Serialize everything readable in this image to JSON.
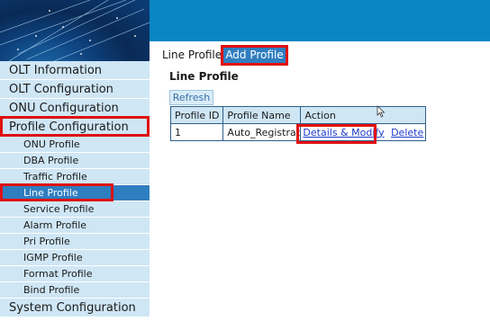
{
  "sidebar": {
    "items": [
      {
        "label": "OLT Information"
      },
      {
        "label": "OLT Configuration"
      },
      {
        "label": "ONU Configuration"
      },
      {
        "label": "Profile Configuration"
      }
    ],
    "sub_items": [
      {
        "label": "ONU Profile"
      },
      {
        "label": "DBA Profile"
      },
      {
        "label": "Traffic Profile"
      },
      {
        "label": "Line Profile"
      },
      {
        "label": "Service Profile"
      },
      {
        "label": "Alarm Profile"
      },
      {
        "label": "Pri Profile"
      },
      {
        "label": "IGMP Profile"
      },
      {
        "label": "Format Profile"
      },
      {
        "label": "Bind Profile"
      }
    ],
    "footer_item": {
      "label": "System Configuration"
    },
    "active_sub_item": "Line Profile"
  },
  "tabs": {
    "line_profile": "Line Profile",
    "add_profile": "Add Profile"
  },
  "main": {
    "title": "Line Profile",
    "refresh_label": "Refresh",
    "table": {
      "headers": [
        "Profile ID",
        "Profile Name",
        "Action"
      ],
      "rows": [
        {
          "id": "1",
          "name": "Auto_Registrati",
          "details": "Details & Modify",
          "delete": "Delete"
        }
      ]
    }
  },
  "colors": {
    "banner": "#0b86c4",
    "menu_bg": "#cfe6f5",
    "active": "#2f7ec0",
    "highlight": "#e01010",
    "link": "#1a39c8"
  }
}
